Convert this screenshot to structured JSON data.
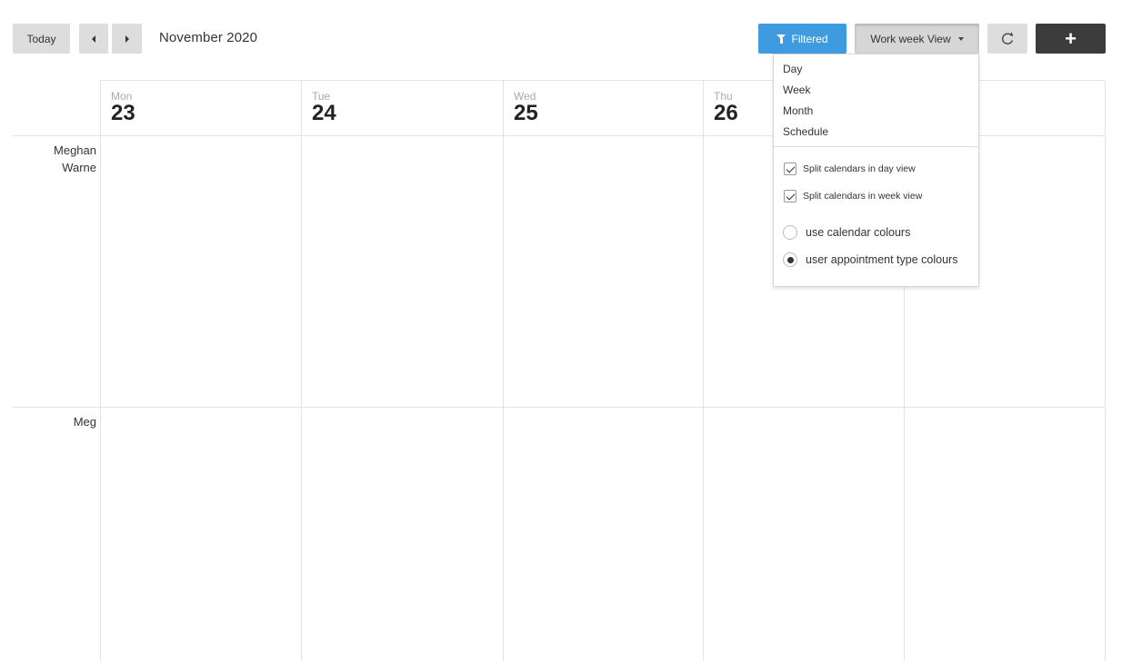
{
  "toolbar": {
    "today_label": "Today",
    "prev_icon": "caret-left-icon",
    "next_icon": "caret-right-icon",
    "month_title": "November 2020",
    "filtered_label": "Filtered",
    "filter_icon": "funnel-icon",
    "view_label": "Work week View",
    "refresh_icon": "↻",
    "add_label": "+",
    "accent_color": "#3f9be0"
  },
  "days": [
    {
      "dow": "Mon",
      "date": "23"
    },
    {
      "dow": "Tue",
      "date": "24"
    },
    {
      "dow": "Wed",
      "date": "25"
    },
    {
      "dow": "Thu",
      "date": "26"
    }
  ],
  "resources": [
    {
      "line1": "Meghan",
      "line2": "Warne"
    },
    {
      "line1": "Meg",
      "line2": ""
    }
  ],
  "view_menu": {
    "items": [
      "Day",
      "Week",
      "Month",
      "Schedule"
    ],
    "checkboxes": [
      {
        "label": "Split calendars in day view",
        "checked": true
      },
      {
        "label": "Split calendars in week view",
        "checked": true
      }
    ],
    "radios": [
      {
        "label": "use calendar colours",
        "selected": false
      },
      {
        "label": "user appointment type colours",
        "selected": true
      }
    ]
  }
}
